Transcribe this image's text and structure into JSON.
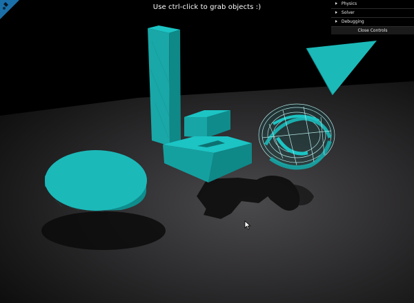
{
  "hint": "Use ctrl-click to grab objects :)",
  "gui": {
    "folders": [
      {
        "label": "Physics"
      },
      {
        "label": "Solver"
      },
      {
        "label": "Debugging"
      }
    ],
    "close_label": "Close Controls"
  },
  "colors": {
    "background": "#000000",
    "object": "#14a9a9",
    "object_top": "#1cc4c4",
    "floor_light": "#3b3a3c",
    "floor_dark": "#1b1b1b"
  },
  "icons": [
    "github-corner-icon",
    "folder-arrow-icon",
    "mouse-cursor-icon"
  ]
}
